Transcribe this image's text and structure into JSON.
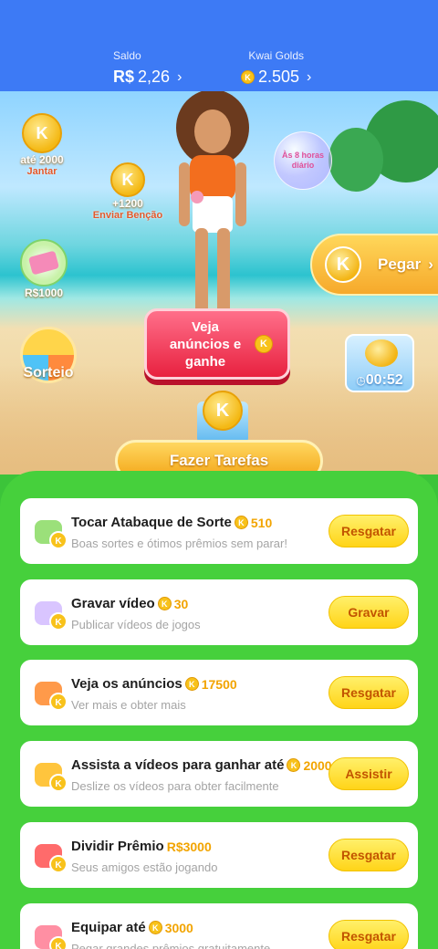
{
  "header": {
    "saldo_label": "Saldo",
    "saldo_currency": "R$",
    "saldo_value": "2,26",
    "golds_label": "Kwai Golds",
    "golds_value": "2.505",
    "chevron": "›"
  },
  "scene": {
    "left_items": [
      {
        "title": "até 2000",
        "sub": "Jantar"
      },
      {
        "title": "+1200",
        "sub": "Enviar Benção"
      },
      {
        "title": "R$1000",
        "sub": ""
      },
      {
        "title": "Sorteio",
        "sub": ""
      }
    ],
    "bubble_text": "Às 8 horas diário",
    "pegar_label": "Pegar",
    "veja_label": "Veja anúncios e ganhe",
    "timer": "00:52",
    "fazer_label": "Fazer Tarefas",
    "coin_letter": "K"
  },
  "tasks": [
    {
      "title": "Tocar Atabaque de Sorte",
      "reward": "510",
      "reward_type": "coin",
      "desc": "Boas sortes e ótimos prêmios sem parar!",
      "button": "Resgatar",
      "icon": "drum-icon"
    },
    {
      "title": "Gravar vídeo",
      "reward": "30",
      "reward_type": "coin",
      "desc": "Publicar vídeos de jogos",
      "button": "Gravar",
      "icon": "record-video-icon"
    },
    {
      "title": "Veja os anúncios",
      "reward": "17500",
      "reward_type": "coin",
      "desc": "Ver mais e obter mais",
      "button": "Resgatar",
      "icon": "tv-icon"
    },
    {
      "title": "Assista a vídeos para ganhar até",
      "reward": "2000",
      "reward_type": "coin",
      "desc": "Deslize os vídeos para obter facilmente",
      "button": "Assistir",
      "icon": "camera-icon"
    },
    {
      "title": "Dividir Prêmio",
      "reward": "R$3000",
      "reward_type": "cash",
      "desc": "Seus amigos estão jogando",
      "button": "Resgatar",
      "icon": "gift-icon"
    },
    {
      "title": "Equipar até",
      "reward": "3000",
      "reward_type": "coin",
      "desc": "Pegar grandes prêmios gratuitamente",
      "button": "Resgatar",
      "icon": "equip-gift-icon"
    }
  ],
  "colors": {
    "header": "#3d7af5",
    "panel": "#46d03c",
    "button": "#ffd418",
    "accent": "#f2a400"
  }
}
